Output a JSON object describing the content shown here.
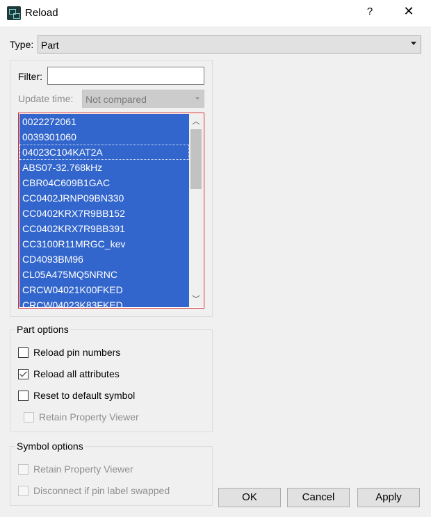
{
  "window": {
    "title": "Reload",
    "help_glyph": "?",
    "close_glyph": "✕"
  },
  "type": {
    "label": "Type:",
    "value": "Part"
  },
  "filter": {
    "label": "Filter:",
    "value": ""
  },
  "update_time": {
    "label": "Update time:",
    "value": "Not compared"
  },
  "list": {
    "items": [
      "0022272061",
      "0039301060",
      "04023C104KAT2A",
      "ABS07-32.768kHz",
      "CBR04C609B1GAC",
      "CC0402JRNP09BN330",
      "CC0402KRX7R9BB152",
      "CC0402KRX7R9BB391",
      "CC3100R11MRGC_kev",
      "CD4093BM96",
      "CL05A475MQ5NRNC",
      "CRCW04021K00FKED",
      "CRCW04023K83FKED"
    ],
    "all_selected": true,
    "focused_index": 2
  },
  "part_options": {
    "title": "Part options",
    "options": [
      {
        "label": "Reload pin numbers",
        "checked": false,
        "enabled": true
      },
      {
        "label": "Reload all attributes",
        "checked": true,
        "enabled": true
      },
      {
        "label": "Reset to default symbol",
        "checked": false,
        "enabled": true
      },
      {
        "label": "Retain Property Viewer",
        "checked": false,
        "enabled": false
      }
    ]
  },
  "symbol_options": {
    "title": "Symbol options",
    "options": [
      {
        "label": "Retain Property Viewer",
        "checked": false,
        "enabled": false
      },
      {
        "label": "Disconnect if pin label swapped",
        "checked": false,
        "enabled": false
      }
    ]
  },
  "buttons": {
    "ok": "OK",
    "cancel": "Cancel",
    "apply": "Apply"
  }
}
